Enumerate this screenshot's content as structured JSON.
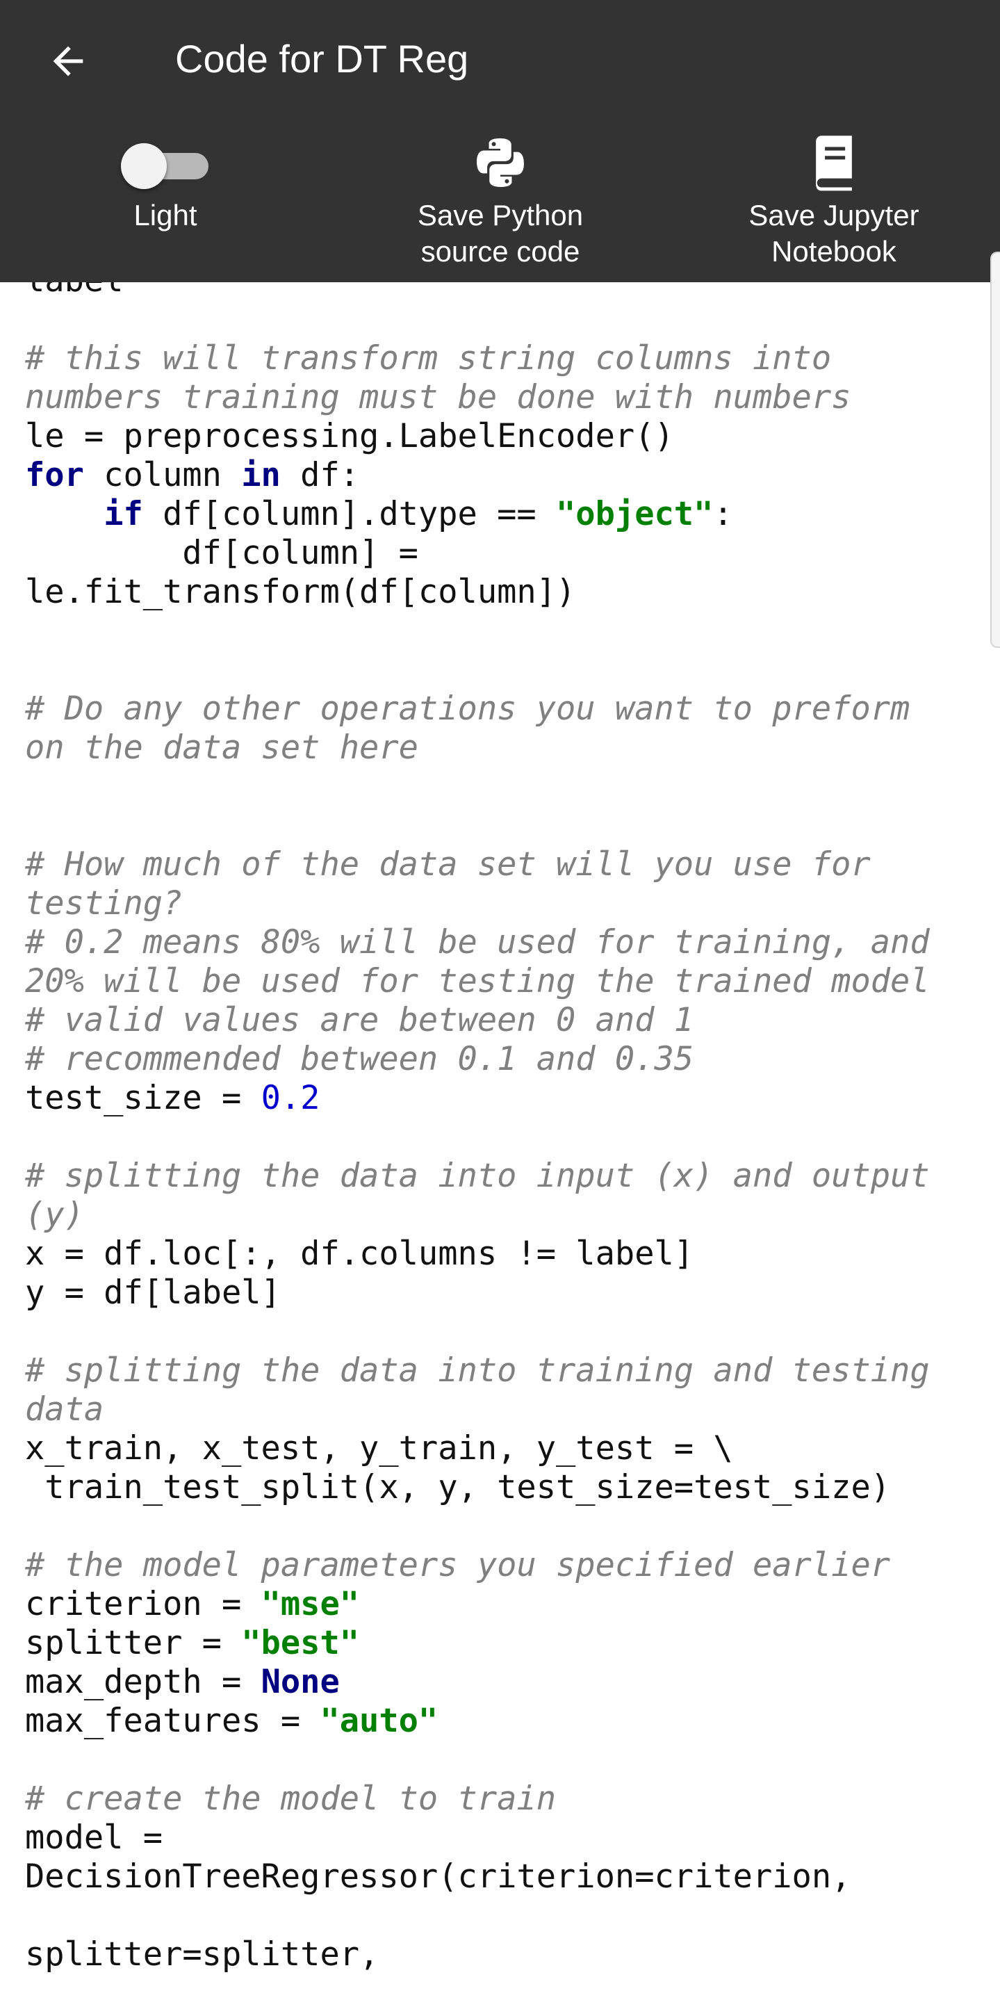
{
  "appbar": {
    "title": "Code for DT Reg",
    "back_icon": "arrow-left-icon",
    "actions": [
      {
        "label": "Light",
        "icon": "toggle-switch",
        "state": "off"
      },
      {
        "label": "Save Python\nsource code",
        "icon": "python-logo-icon"
      },
      {
        "label": "Save Jupyter\nNotebook",
        "icon": "notebook-icon"
      }
    ]
  },
  "colors": {
    "appbar": "#333333",
    "comment": "#808080",
    "keyword": "#000080",
    "string": "#008000",
    "number": "#0000cc"
  },
  "code_lines": [
    [
      {
        "t": "label",
        "c": "tx"
      }
    ],
    [],
    [
      {
        "t": "# this will transform string columns into",
        "c": "cm"
      }
    ],
    [
      {
        "t": "numbers training must be done with numbers",
        "c": "cm"
      }
    ],
    [
      {
        "t": "le = preprocessing.LabelEncoder()",
        "c": "tx"
      }
    ],
    [
      {
        "t": "for",
        "c": "kw"
      },
      {
        "t": " column ",
        "c": "tx"
      },
      {
        "t": "in",
        "c": "kw"
      },
      {
        "t": " df:",
        "c": "tx"
      }
    ],
    [
      {
        "t": "    ",
        "c": "tx"
      },
      {
        "t": "if",
        "c": "kw"
      },
      {
        "t": " df[column].dtype == ",
        "c": "tx"
      },
      {
        "t": "\"object\"",
        "c": "st"
      },
      {
        "t": ":",
        "c": "tx"
      }
    ],
    [
      {
        "t": "        df[column] =",
        "c": "tx"
      }
    ],
    [
      {
        "t": "le.fit_transform(df[column])",
        "c": "tx"
      }
    ],
    [],
    [],
    [
      {
        "t": "# Do any other operations you want to preform",
        "c": "cm"
      }
    ],
    [
      {
        "t": "on the data set here",
        "c": "cm"
      }
    ],
    [],
    [],
    [
      {
        "t": "# How much of the data set will you use for",
        "c": "cm"
      }
    ],
    [
      {
        "t": "testing?",
        "c": "cm"
      }
    ],
    [
      {
        "t": "# 0.2 means 80% will be used for training, and",
        "c": "cm"
      }
    ],
    [
      {
        "t": "20% will be used for testing the trained model",
        "c": "cm"
      }
    ],
    [
      {
        "t": "# valid values are between 0 and 1",
        "c": "cm"
      }
    ],
    [
      {
        "t": "# recommended between 0.1 and 0.35",
        "c": "cm"
      }
    ],
    [
      {
        "t": "test_size = ",
        "c": "tx"
      },
      {
        "t": "0.2",
        "c": "nm"
      }
    ],
    [],
    [
      {
        "t": "# splitting the data into input (x) and output",
        "c": "cm"
      }
    ],
    [
      {
        "t": "(y)",
        "c": "cm"
      }
    ],
    [
      {
        "t": "x = df.loc[:, df.columns != label]",
        "c": "tx"
      }
    ],
    [
      {
        "t": "y = df[label]",
        "c": "tx"
      }
    ],
    [],
    [
      {
        "t": "# splitting the data into training and testing",
        "c": "cm"
      }
    ],
    [
      {
        "t": "data",
        "c": "cm"
      }
    ],
    [
      {
        "t": "x_train, x_test, y_train, y_test = \\",
        "c": "tx"
      }
    ],
    [
      {
        "t": " train_test_split(x, y, test_size=test_size)",
        "c": "tx"
      }
    ],
    [],
    [
      {
        "t": "# the model parameters you specified earlier",
        "c": "cm"
      }
    ],
    [
      {
        "t": "criterion = ",
        "c": "tx"
      },
      {
        "t": "\"mse\"",
        "c": "st"
      }
    ],
    [
      {
        "t": "splitter = ",
        "c": "tx"
      },
      {
        "t": "\"best\"",
        "c": "st"
      }
    ],
    [
      {
        "t": "max_depth = ",
        "c": "tx"
      },
      {
        "t": "None",
        "c": "kw"
      }
    ],
    [
      {
        "t": "max_features = ",
        "c": "tx"
      },
      {
        "t": "\"auto\"",
        "c": "st"
      }
    ],
    [],
    [
      {
        "t": "# create the model to train",
        "c": "cm"
      }
    ],
    [
      {
        "t": "model =",
        "c": "tx"
      }
    ],
    [
      {
        "t": "DecisionTreeRegressor(criterion=criterion,",
        "c": "tx"
      }
    ],
    [],
    [
      {
        "t": "splitter=splitter,",
        "c": "tx"
      }
    ]
  ]
}
